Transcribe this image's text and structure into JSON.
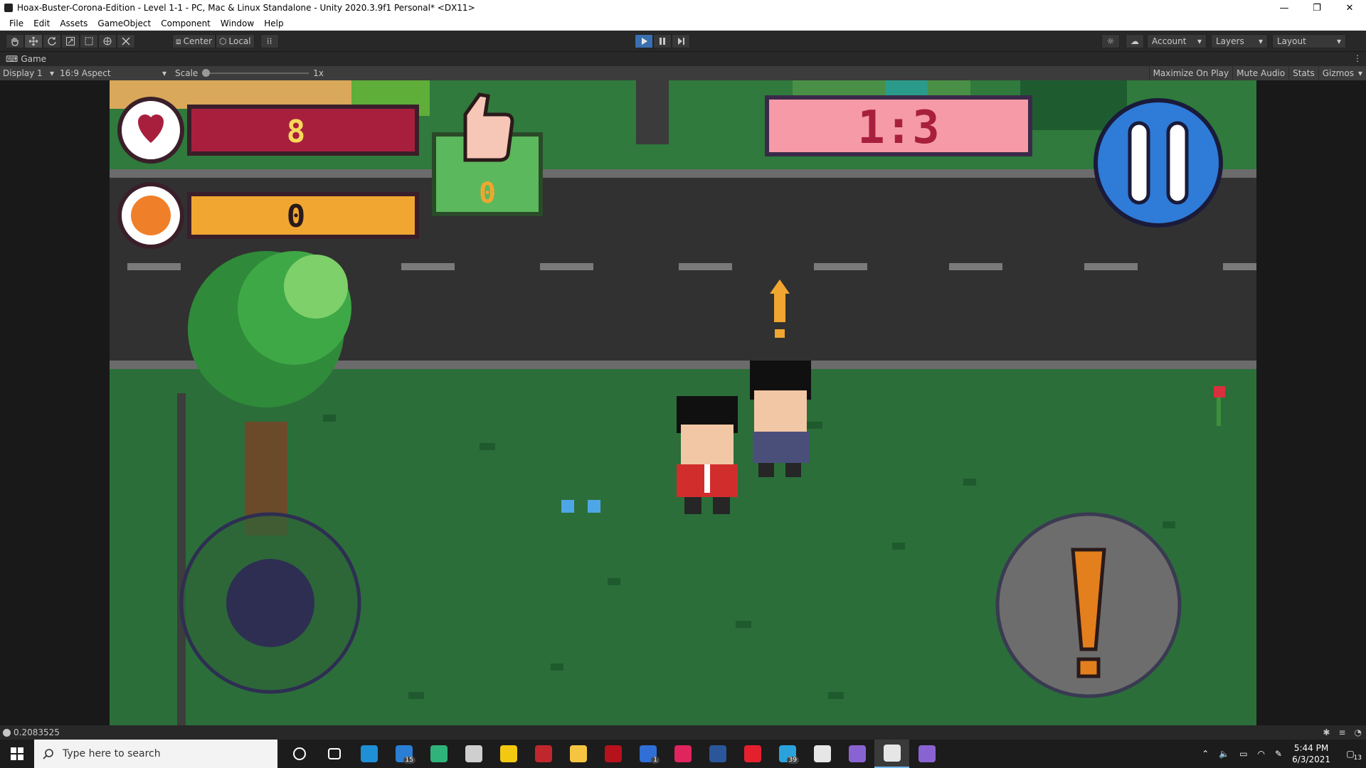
{
  "window": {
    "title": "Hoax-Buster-Corona-Edition - Level 1-1 - PC, Mac & Linux Standalone - Unity 2020.3.9f1 Personal* <DX11>",
    "controls": [
      "—",
      "❐",
      "✕"
    ]
  },
  "menu": [
    "File",
    "Edit",
    "Assets",
    "GameObject",
    "Component",
    "Window",
    "Help"
  ],
  "toolbar": {
    "pivot_label": "Center",
    "space_label": "Local",
    "account_label": "Account",
    "layers_label": "Layers",
    "layout_label": "Layout"
  },
  "game_tab": {
    "label": "Game"
  },
  "game_bar": {
    "display": "Display 1",
    "aspect": "16:9 Aspect",
    "scale_label": "Scale",
    "scale_value": "1x",
    "buttons": [
      "Maximize On Play",
      "Mute Audio",
      "Stats",
      "Gizmos"
    ]
  },
  "hud": {
    "health_value": "8",
    "coin_value": "0",
    "likes_value": "0",
    "timer": "1:3"
  },
  "status_bar": {
    "message": "0.2083525"
  },
  "taskbar": {
    "search_placeholder": "Type here to search",
    "time": "5:44 PM",
    "date": "6/3/2021",
    "notification_count": "13",
    "mail_badge": "15",
    "todo_badge": "1",
    "telegram_badge": "39",
    "apps": [
      {
        "name": "cortana-icon",
        "color": "#1c1c1c",
        "badge": ""
      },
      {
        "name": "task-view-icon",
        "color": "#1c1c1c",
        "badge": ""
      },
      {
        "name": "edge-icon",
        "color": "#1f8fd6",
        "badge": ""
      },
      {
        "name": "mail-icon",
        "color": "#2a7fd4",
        "badge": "15"
      },
      {
        "name": "gitkraken-icon",
        "color": "#2fb37a",
        "badge": ""
      },
      {
        "name": "store-icon",
        "color": "#cfcfcf",
        "badge": ""
      },
      {
        "name": "sticky-notes-icon",
        "color": "#f2c811",
        "badge": ""
      },
      {
        "name": "game-icon",
        "color": "#c0272d",
        "badge": ""
      },
      {
        "name": "file-explorer-icon",
        "color": "#f5c542",
        "badge": ""
      },
      {
        "name": "app-red-icon",
        "color": "#b5121b",
        "badge": ""
      },
      {
        "name": "todo-icon",
        "color": "#2f6fd6",
        "badge": "1"
      },
      {
        "name": "opera-gx-icon",
        "color": "#e0245e",
        "badge": ""
      },
      {
        "name": "word-icon",
        "color": "#2b579a",
        "badge": ""
      },
      {
        "name": "opera-icon",
        "color": "#e5202e",
        "badge": ""
      },
      {
        "name": "telegram-icon",
        "color": "#2aa3dd",
        "badge": "39"
      },
      {
        "name": "twitch-icon",
        "color": "#e6e6e6",
        "badge": ""
      },
      {
        "name": "github-icon",
        "color": "#8a63d2",
        "badge": ""
      },
      {
        "name": "unity-icon",
        "color": "#e6e6e6",
        "badge": ""
      },
      {
        "name": "visual-studio-icon",
        "color": "#8a63d2",
        "badge": ""
      }
    ]
  },
  "colors": {
    "grass": "#2b6e3a",
    "road": "#313131",
    "health_bar": "#a81f3e",
    "coin_bar": "#f0a630",
    "likes_panel": "#5cb85c",
    "timer_panel": "#f59aa6",
    "pause_button": "#2f7bd8"
  }
}
